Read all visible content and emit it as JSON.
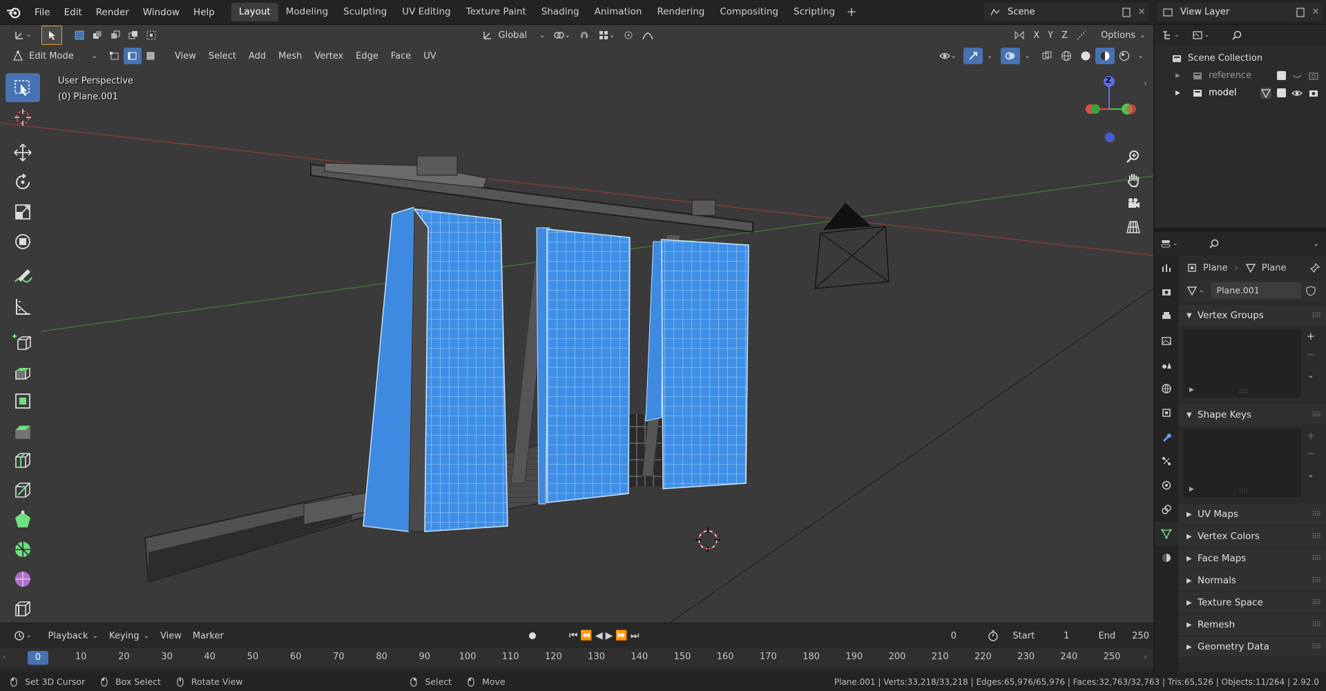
{
  "menu": {
    "file": "File",
    "edit": "Edit",
    "render": "Render",
    "window": "Window",
    "help": "Help"
  },
  "workspaces": [
    "Layout",
    "Modeling",
    "Sculpting",
    "UV Editing",
    "Texture Paint",
    "Shading",
    "Animation",
    "Rendering",
    "Compositing",
    "Scripting"
  ],
  "active_workspace": "Layout",
  "scene": {
    "label": "Scene"
  },
  "view_layer": {
    "label": "View Layer"
  },
  "viewport_header": {
    "transform_orientation": "Global",
    "axes": [
      "X",
      "Y",
      "Z"
    ],
    "options": "Options",
    "mode": "Edit Mode",
    "menus": [
      "View",
      "Select",
      "Add",
      "Mesh",
      "Vertex",
      "Edge",
      "Face",
      "UV"
    ]
  },
  "viewport_overlay": {
    "view_name": "User Perspective",
    "object_name": "(0) Plane.001",
    "gizmo_z": "Z"
  },
  "outliner": {
    "root": "Scene Collection",
    "items": [
      "reference",
      "model"
    ]
  },
  "properties": {
    "breadcrumb_object": "Plane",
    "breadcrumb_mesh": "Plane",
    "mesh_name": "Plane.001",
    "panels": [
      "Vertex Groups",
      "Shape Keys",
      "UV Maps",
      "Vertex Colors",
      "Face Maps",
      "Normals",
      "Texture Space",
      "Remesh",
      "Geometry Data"
    ]
  },
  "timeline": {
    "menus": [
      "Playback",
      "Keying",
      "View",
      "Marker"
    ],
    "current_frame": "0",
    "start_label": "Start",
    "start": "1",
    "end_label": "End",
    "end": "250",
    "ticks": [
      "0",
      "10",
      "20",
      "30",
      "40",
      "50",
      "60",
      "70",
      "80",
      "90",
      "100",
      "110",
      "120",
      "130",
      "140",
      "150",
      "160",
      "170",
      "180",
      "190",
      "200",
      "210",
      "220",
      "230",
      "240",
      "250"
    ]
  },
  "statusbar": {
    "set_cursor": "Set 3D Cursor",
    "box_select": "Box Select",
    "rotate_view": "Rotate View",
    "select": "Select",
    "move": "Move",
    "stats": "Plane.001 | Verts:33,218/33,218 | Edges:65,976/65,976 | Faces:32,763/32,763 | Tris:65,526 | Objects:11/264 | 2.92.0"
  },
  "colors": {
    "accent": "#4772b3",
    "selection": "#5aa0e8",
    "axis_x": "#e64b4b",
    "axis_y": "#4cc64c",
    "axis_z": "#5a6ee6"
  }
}
